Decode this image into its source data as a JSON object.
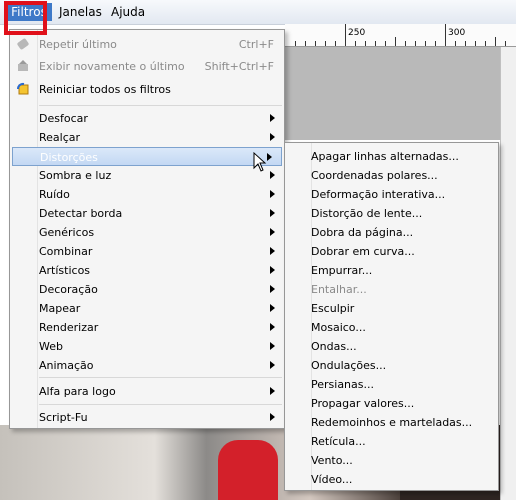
{
  "menubar": {
    "items": [
      "Filtros",
      "Janelas",
      "Ajuda"
    ]
  },
  "ruler": {
    "labels": [
      "250",
      "300"
    ]
  },
  "menu": {
    "items": [
      {
        "label": "Repetir último",
        "shortcut": "Ctrl+F",
        "disabled": true,
        "icon": "repeat-icon"
      },
      {
        "label": "Exibir novamente o último",
        "shortcut": "Shift+Ctrl+F",
        "disabled": true,
        "icon": "reshow-icon"
      },
      {
        "label": "Reiniciar todos os filtros",
        "icon": "reset-icon"
      },
      {
        "label": "Desfocar"
      },
      {
        "label": "Realçar"
      },
      {
        "label": "Distorções",
        "selected": true
      },
      {
        "label": "Sombra e luz"
      },
      {
        "label": "Ruído"
      },
      {
        "label": "Detectar borda"
      },
      {
        "label": "Genéricos"
      },
      {
        "label": "Combinar"
      },
      {
        "label": "Artísticos"
      },
      {
        "label": "Decoração"
      },
      {
        "label": "Mapear"
      },
      {
        "label": "Renderizar"
      },
      {
        "label": "Web"
      },
      {
        "label": "Animação"
      },
      {
        "label": "Alfa para logo"
      },
      {
        "label": "Script-Fu"
      }
    ]
  },
  "submenu": {
    "items": [
      {
        "label": "Apagar linhas alternadas..."
      },
      {
        "label": "Coordenadas polares..."
      },
      {
        "label": "Deformação interativa..."
      },
      {
        "label": "Distorção de lente..."
      },
      {
        "label": "Dobra da página..."
      },
      {
        "label": "Dobrar em curva..."
      },
      {
        "label": "Empurrar..."
      },
      {
        "label": "Entalhar...",
        "disabled": true
      },
      {
        "label": "Esculpir"
      },
      {
        "label": "Mosaico..."
      },
      {
        "label": "Ondas..."
      },
      {
        "label": "Ondulações..."
      },
      {
        "label": "Persianas..."
      },
      {
        "label": "Propagar valores..."
      },
      {
        "label": "Redemoinhos e marteladas..."
      },
      {
        "label": "Retícula..."
      },
      {
        "label": "Vento..."
      },
      {
        "label": "Vídeo..."
      }
    ]
  },
  "colors": {
    "highlight_box": "#e0101a",
    "menu_selected": "#3e79c8"
  }
}
